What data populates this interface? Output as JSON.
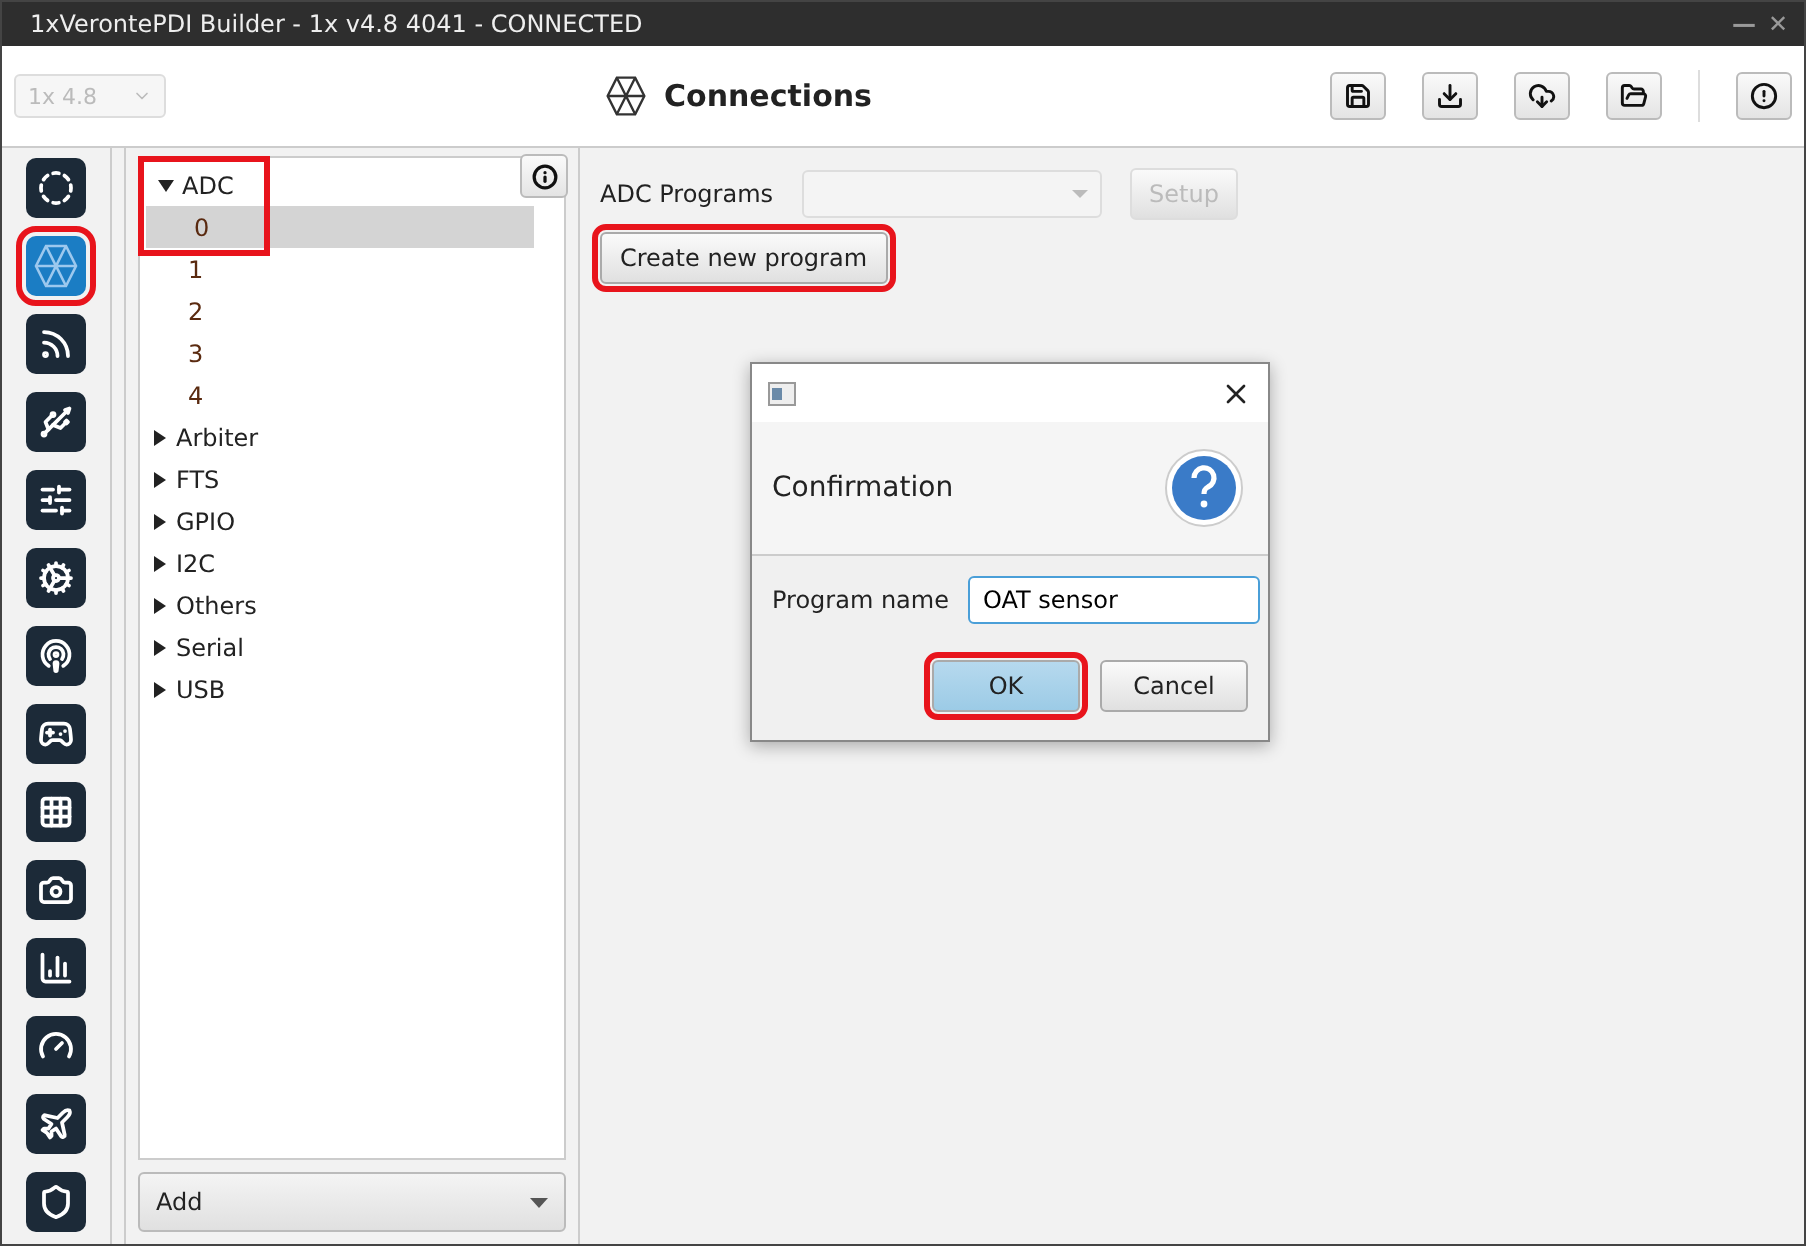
{
  "window": {
    "title": "1xVerontePDI Builder - 1x v4.8 4041 - CONNECTED",
    "controls": [
      "—",
      "✕"
    ]
  },
  "header": {
    "version_select": {
      "value": "1x 4.8",
      "disabled": true
    },
    "title": "Connections"
  },
  "toolbar": [
    {
      "kind": "save"
    },
    {
      "kind": "download"
    },
    {
      "kind": "cloud"
    },
    {
      "kind": "folder"
    },
    {
      "kind": "alert"
    }
  ],
  "sidebar": [
    {
      "kind": "power",
      "selected": false,
      "highlighted": false
    },
    {
      "kind": "connections",
      "selected": true,
      "highlighted": true
    },
    {
      "kind": "rss",
      "selected": false,
      "highlighted": false
    },
    {
      "kind": "usb",
      "selected": false,
      "highlighted": false
    },
    {
      "kind": "sliders",
      "selected": false,
      "highlighted": false
    },
    {
      "kind": "cogs",
      "selected": false,
      "highlighted": false
    },
    {
      "kind": "podcast",
      "selected": false,
      "highlighted": false
    },
    {
      "kind": "gamepad",
      "selected": false,
      "highlighted": false
    },
    {
      "kind": "grid",
      "selected": false,
      "highlighted": false
    },
    {
      "kind": "camera",
      "selected": false,
      "highlighted": false
    },
    {
      "kind": "chart",
      "selected": false,
      "highlighted": false
    },
    {
      "kind": "gauge",
      "selected": false,
      "highlighted": false
    },
    {
      "kind": "plane",
      "selected": false,
      "highlighted": false
    },
    {
      "kind": "shield",
      "selected": false,
      "highlighted": false
    }
  ],
  "tree": [
    {
      "label": "ADC",
      "expanded": true,
      "highlighted": true,
      "children": [
        {
          "label": "0",
          "selected": true
        },
        {
          "label": "1",
          "selected": false
        },
        {
          "label": "2",
          "selected": false
        },
        {
          "label": "3",
          "selected": false
        },
        {
          "label": "4",
          "selected": false
        }
      ]
    },
    {
      "label": "Arbiter",
      "expanded": false,
      "highlighted": false
    },
    {
      "label": "FTS",
      "expanded": false,
      "highlighted": false
    },
    {
      "label": "GPIO",
      "expanded": false,
      "highlighted": false
    },
    {
      "label": "I2C",
      "expanded": false,
      "highlighted": false
    },
    {
      "label": "Others",
      "expanded": false,
      "highlighted": false
    },
    {
      "label": "Serial",
      "expanded": false,
      "highlighted": false
    },
    {
      "label": "USB",
      "expanded": false,
      "highlighted": false
    }
  ],
  "add_select": {
    "value": "Add"
  },
  "programs": {
    "label": "ADC Programs",
    "setup_button": {
      "label": "Setup",
      "disabled": true
    },
    "create_button": {
      "label": "Create new program",
      "highlighted": true
    }
  },
  "dialog": {
    "heading": "Confirmation",
    "field_label": "Program name",
    "field_value": "OAT sensor",
    "ok_button": {
      "label": "OK",
      "highlighted": true
    },
    "cancel_button": {
      "label": "Cancel",
      "highlighted": false
    }
  }
}
